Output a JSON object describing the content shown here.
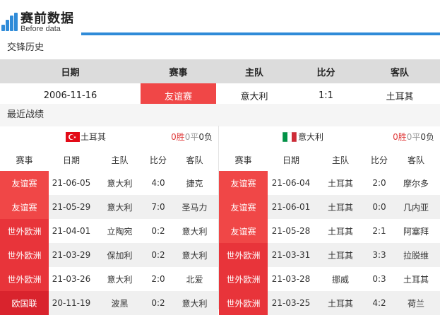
{
  "header": {
    "title": "赛前数据",
    "subtitle": "Before data"
  },
  "history": {
    "section_title": "交锋历史",
    "columns": [
      "日期",
      "赛事",
      "主队",
      "比分",
      "客队"
    ],
    "rows": [
      {
        "date": "2006-11-16",
        "comp": "友谊赛",
        "home": "意大利",
        "score": "1:1",
        "away": "土耳其"
      }
    ]
  },
  "recent": {
    "section_title": "最近战绩",
    "columns": [
      "赛事",
      "日期",
      "主队",
      "比分",
      "客队"
    ],
    "left": {
      "team": "土耳其",
      "flag_icon": "turkey-flag-icon",
      "wins": "0胜",
      "draws": "0平",
      "losses": "0负",
      "rows": [
        {
          "comp": "友谊赛",
          "date": "21-06-05",
          "home": "意大利",
          "score": "4:0",
          "away": "捷克"
        },
        {
          "comp": "友谊赛",
          "date": "21-05-29",
          "home": "意大利",
          "score": "7:0",
          "away": "圣马力"
        },
        {
          "comp": "世外欧洲",
          "date": "21-04-01",
          "home": "立陶宛",
          "score": "0:2",
          "away": "意大利"
        },
        {
          "comp": "世外欧洲",
          "date": "21-03-29",
          "home": "保加利",
          "score": "0:2",
          "away": "意大利"
        },
        {
          "comp": "世外欧洲",
          "date": "21-03-26",
          "home": "意大利",
          "score": "2:0",
          "away": "北爱"
        },
        {
          "comp": "欧国联",
          "date": "20-11-19",
          "home": "波黑",
          "score": "0:2",
          "away": "意大利"
        }
      ]
    },
    "right": {
      "team": "意大利",
      "flag_icon": "italy-flag-icon",
      "wins": "0胜",
      "draws": "0平",
      "losses": "0负",
      "rows": [
        {
          "comp": "友谊赛",
          "date": "21-06-04",
          "home": "土耳其",
          "score": "2:0",
          "away": "摩尔多"
        },
        {
          "comp": "友谊赛",
          "date": "21-06-01",
          "home": "土耳其",
          "score": "0:0",
          "away": "几内亚"
        },
        {
          "comp": "友谊赛",
          "date": "21-05-28",
          "home": "土耳其",
          "score": "2:1",
          "away": "阿塞拜"
        },
        {
          "comp": "世外欧洲",
          "date": "21-03-31",
          "home": "土耳其",
          "score": "3:3",
          "away": "拉脱维"
        },
        {
          "comp": "世外欧洲",
          "date": "21-03-28",
          "home": "挪威",
          "score": "0:3",
          "away": "土耳其"
        },
        {
          "comp": "世外欧洲",
          "date": "21-03-25",
          "home": "土耳其",
          "score": "4:2",
          "away": "荷兰"
        }
      ]
    }
  },
  "colors": {
    "accent_blue": "#2f8bd8",
    "friendly_red": "#f04747",
    "wc_qual_red": "#e8343a",
    "nations_league_red": "#d9232d",
    "win_red": "#e03c3c"
  }
}
